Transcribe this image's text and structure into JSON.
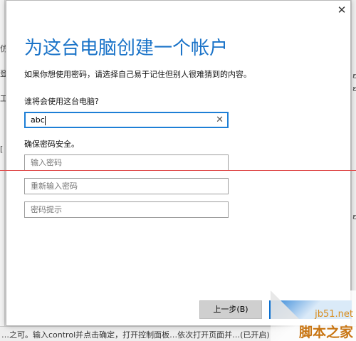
{
  "background": {
    "left_glyphs": [
      "仿",
      "登",
      "工",
      "["
    ],
    "right_glyphs": [
      "ε",
      "ε",
      "ε"
    ],
    "bottom_text": "…之可。输入control并点击确定，打开控制面板…依次打开页面并…(已开启)"
  },
  "dialog": {
    "close_label": "✕",
    "title": "为这台电脑创建一个帐户",
    "description": "如果你想使用密码，请选择自己易于记住但别人很难猜到的内容。",
    "who_label": "谁将会使用这台电脑?",
    "username": {
      "value": "abc",
      "clear_label": "✕"
    },
    "secure_label": "确保密码安全。",
    "password": {
      "placeholder": "输入密码"
    },
    "password_confirm": {
      "placeholder": "重新输入密码"
    },
    "password_hint": {
      "placeholder": "密码提示"
    },
    "back_button": "上一步(B)",
    "next_button": ""
  },
  "watermark": {
    "line1": "jb51.net",
    "line2": "脚本之家"
  },
  "colors": {
    "accent": "#1a73c8",
    "focus_border": "#1e7fd6",
    "primary_button": "#0a6fd0",
    "overlay_line": "#e05050",
    "watermark": "#d98c1a"
  }
}
